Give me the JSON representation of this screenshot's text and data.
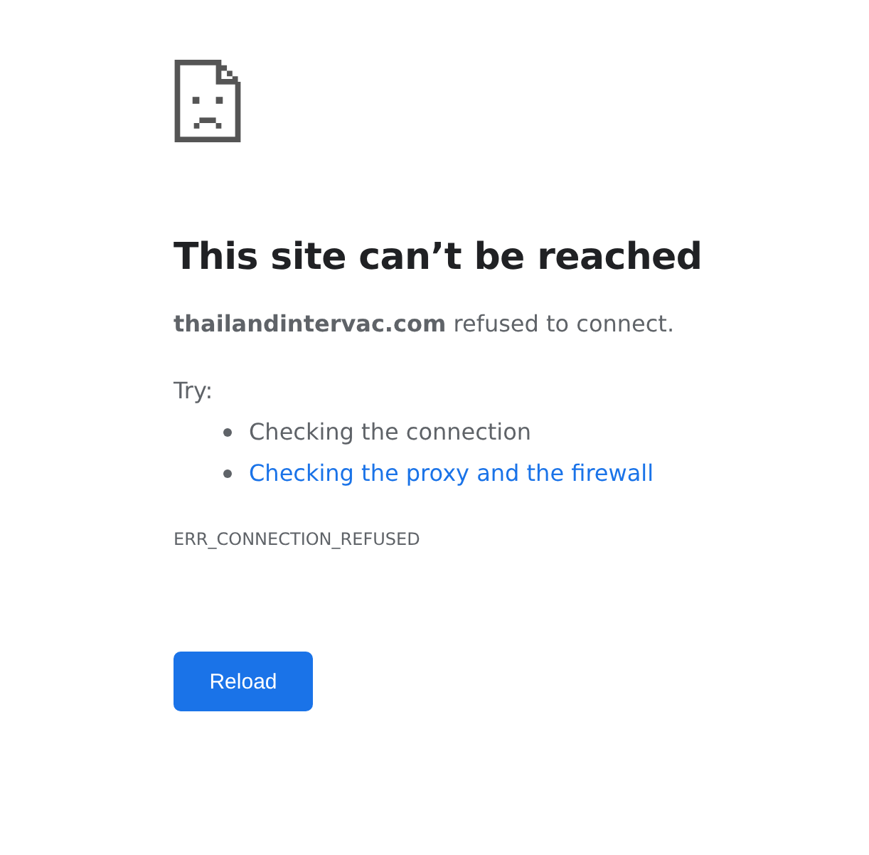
{
  "title": "This site can’t be reached",
  "message": "**thailandintervac.com** refused to connect.",
  "try_label": "Try:",
  "suggestions": [
    {
      "kind": "text",
      "label": "Checking the connection"
    },
    {
      "kind": "link",
      "label": "Checking the proxy and the firewall"
    }
  ],
  "error_code": "ERR_CONNECTION_REFUSED",
  "button": "Reload"
}
